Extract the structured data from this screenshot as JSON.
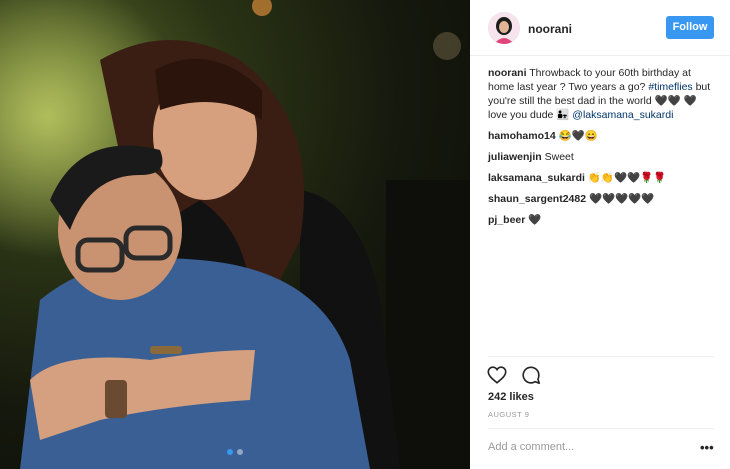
{
  "post": {
    "username": "noorani",
    "follow_label": "Follow",
    "caption_user": "noorani",
    "caption_text": " Throwback to your 60th birthday at home last year ? Two years a go? ",
    "caption_hashtag": "#timeflies",
    "caption_text_2": " but you're still the best dad in the world 🖤🖤 🖤 love you dude 👨‍👧 ",
    "caption_mention": "@laksamana_sukardi",
    "comments": [
      {
        "user": "hamohamo14",
        "text": " 😂🖤😄"
      },
      {
        "user": "juliawenjin",
        "text": " Sweet"
      },
      {
        "user": "laksamana_sukardi",
        "text": " 👏👏🖤🖤🌹🌹"
      },
      {
        "user": "shaun_sargent2482",
        "text": " 🖤🖤🖤🖤🖤"
      },
      {
        "user": "pj_beer",
        "text": " 🖤"
      }
    ],
    "likes": "242 likes",
    "date": "AUGUST 9",
    "add_comment_placeholder": "Add a comment...",
    "more_label": "•••",
    "icons": {
      "like": "heart-icon",
      "comment": "comment-icon",
      "more": "more-options-icon"
    },
    "colors": {
      "accent": "#3897f0",
      "link": "#003569"
    }
  }
}
